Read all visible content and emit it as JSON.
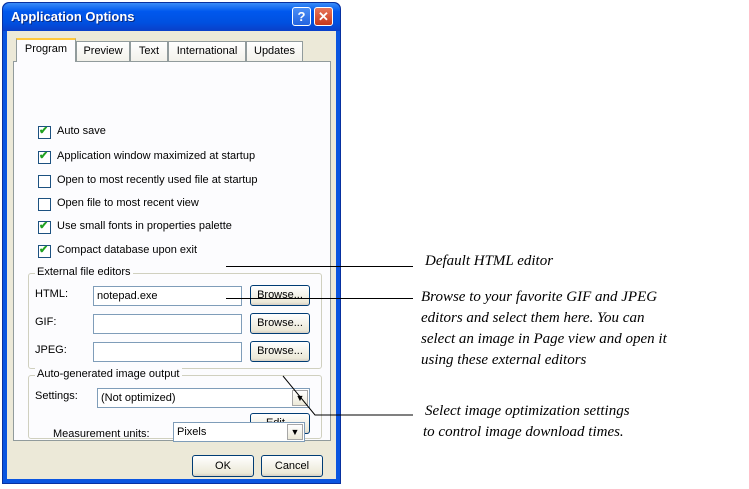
{
  "window": {
    "title": "Application Options",
    "help_icon": "question-mark",
    "close_icon": "x-mark"
  },
  "tabs": [
    "Program",
    "Preview",
    "Text",
    "International",
    "Updates"
  ],
  "active_tab": "Program",
  "options": [
    {
      "label": "Auto save",
      "checked": true
    },
    {
      "label": "Application window maximized at startup",
      "checked": true
    },
    {
      "label": "Open to most recently used file at startup",
      "checked": false
    },
    {
      "label": "Open file to most recent view",
      "checked": false
    },
    {
      "label": "Use small fonts in properties palette",
      "checked": true
    },
    {
      "label": "Compact database upon exit",
      "checked": true
    }
  ],
  "external_editors": {
    "title": "External file editors",
    "html_label": "HTML:",
    "html_value": "notepad.exe",
    "gif_label": "GIF:",
    "gif_value": "",
    "jpeg_label": "JPEG:",
    "jpeg_value": "",
    "browse_label": "Browse..."
  },
  "image_output": {
    "title": "Auto-generated image output",
    "settings_label": "Settings:",
    "settings_value": "(Not optimized)",
    "edit_label": "Edit..."
  },
  "measurement": {
    "label": "Measurement units:",
    "value": "Pixels"
  },
  "buttons": {
    "ok": "OK",
    "cancel": "Cancel"
  },
  "annotations": {
    "html_editor": "Default HTML editor",
    "browse": "Browse to your favorite GIF and JPEG editors and select them here. You can select an image in Page view and open it using these external editors",
    "browse_lines": [
      "Browse to your favorite GIF and JPEG",
      "editors and select them here. You can",
      "select an image in Page view and open it",
      "using these external editors"
    ],
    "optimization_lines": [
      "Select image optimization settings",
      "to control image download times."
    ]
  }
}
